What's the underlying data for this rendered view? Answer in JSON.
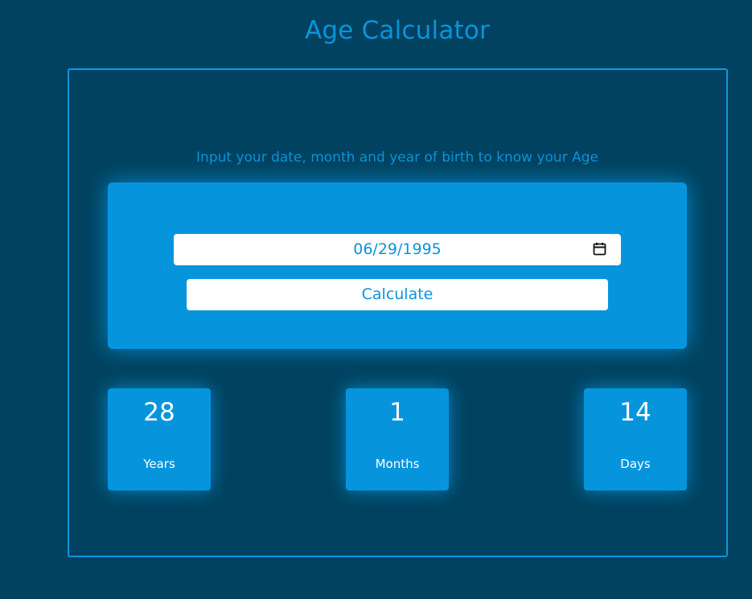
{
  "header": {
    "title": "Age Calculator"
  },
  "form": {
    "instruction": "Input your date, month and year of birth to know your Age",
    "date_value": "06/29/1995",
    "calculate_label": "Calculate",
    "calendar_icon": "calendar-icon"
  },
  "results": [
    {
      "value": "28",
      "label": "Years"
    },
    {
      "value": "1",
      "label": "Months"
    },
    {
      "value": "14",
      "label": "Days"
    }
  ],
  "colors": {
    "background": "#00425f",
    "accent": "#0695dd",
    "text_on_accent": "#ffffff",
    "title_text": "#0a93dd",
    "input_background": "#ffffff"
  }
}
